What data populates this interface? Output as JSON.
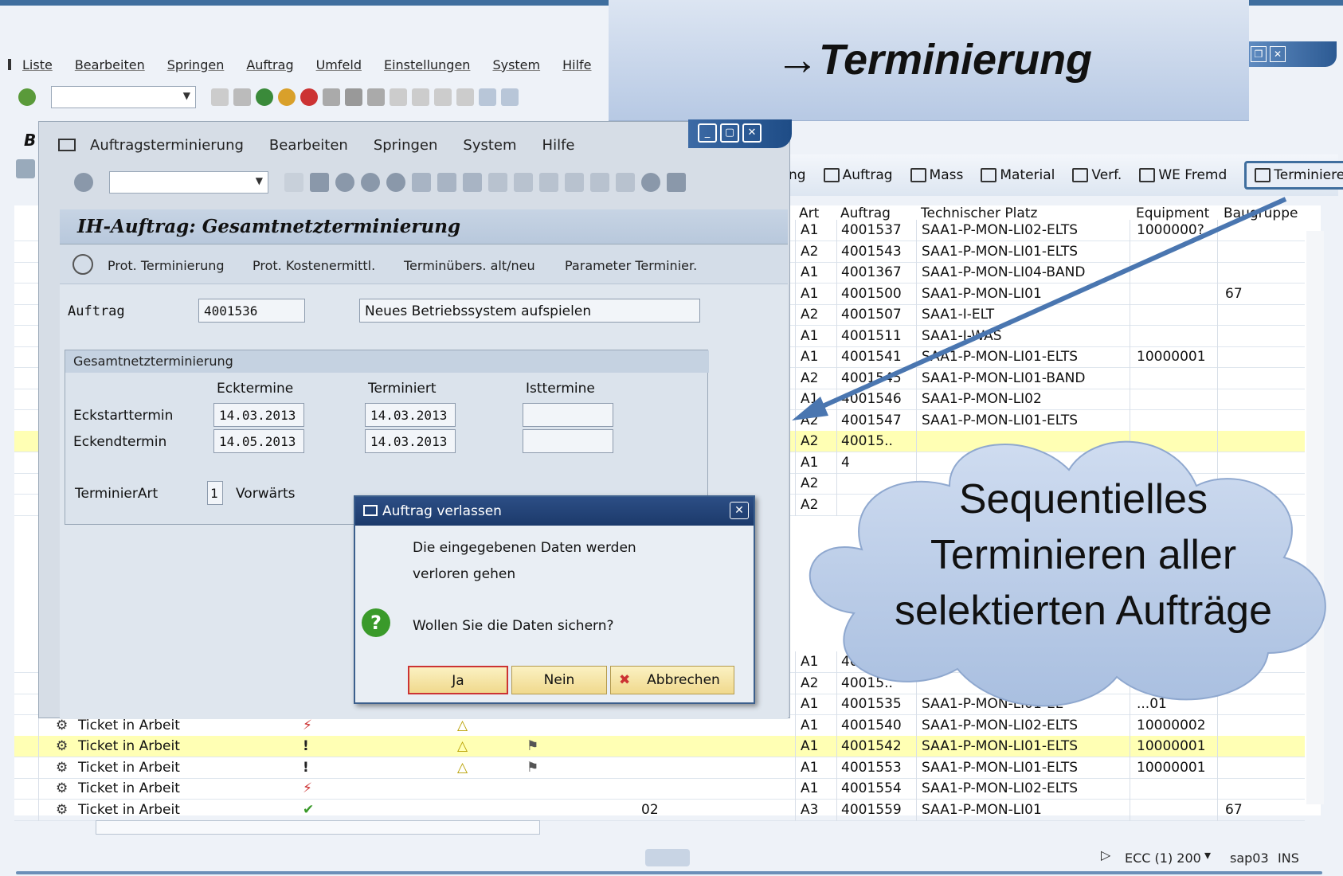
{
  "slide_title": "→Terminierung",
  "callout": {
    "line1": "Sequentielles",
    "line2": "Terminieren aller",
    "line3": "selektierten Aufträge"
  },
  "background_window": {
    "menu": [
      "Liste",
      "Bearbeiten",
      "Springen",
      "Auftrag",
      "Umfeld",
      "Einstellungen",
      "System",
      "Hilfe"
    ],
    "toolbar_buttons": [
      {
        "label": "Auftrag",
        "icon": "print-icon"
      },
      {
        "label": "Mass",
        "icon": "grid-icon"
      },
      {
        "label": "Material",
        "icon": "material-icon"
      },
      {
        "label": "Verf.",
        "icon": "verf-icon"
      },
      {
        "label": "WE Fremd",
        "icon": "edit-icon"
      },
      {
        "label": "Terminieren",
        "icon": "schedule-icon"
      }
    ],
    "toolbar_partial": "ng",
    "title_partial": "B",
    "columns": {
      "art": "Art",
      "auftrag": "Auftrag",
      "techplatz": "Technischer Platz",
      "equipment": "Equipment",
      "baugruppe": "Baugruppe"
    },
    "rows_top": [
      {
        "art": "A1",
        "auftrag": "4001537",
        "techplatz": "SAA1-P-MON-LI02-ELTS",
        "equipment": "1000000?",
        "baugruppe": ""
      },
      {
        "art": "A2",
        "auftrag": "4001543",
        "techplatz": "SAA1-P-MON-LI01-ELTS",
        "equipment": "",
        "baugruppe": ""
      },
      {
        "art": "A1",
        "auftrag": "4001367",
        "techplatz": "SAA1-P-MON-LI04-BAND",
        "equipment": "",
        "baugruppe": ""
      },
      {
        "art": "A1",
        "auftrag": "4001500",
        "techplatz": "SAA1-P-MON-LI01",
        "equipment": "",
        "baugruppe": "67"
      },
      {
        "art": "A2",
        "auftrag": "4001507",
        "techplatz": "SAA1-I-ELT",
        "equipment": "",
        "baugruppe": ""
      },
      {
        "art": "A1",
        "auftrag": "4001511",
        "techplatz": "SAA1-I-WAS",
        "equipment": "",
        "baugruppe": ""
      },
      {
        "art": "A1",
        "auftrag": "4001541",
        "techplatz": "SAA1-P-MON-LI01-ELTS",
        "equipment": "10000001",
        "baugruppe": ""
      },
      {
        "art": "A2",
        "auftrag": "4001545",
        "techplatz": "SAA1-P-MON-LI01-BAND",
        "equipment": "",
        "baugruppe": ""
      },
      {
        "art": "A1",
        "auftrag": "4001546",
        "techplatz": "SAA1-P-MON-LI02",
        "equipment": "",
        "baugruppe": ""
      },
      {
        "art": "A2",
        "auftrag": "4001547",
        "techplatz": "SAA1-P-MON-LI01-ELTS",
        "equipment": "",
        "baugruppe": ""
      },
      {
        "art": "A2",
        "auftrag": "40015..",
        "techplatz": "",
        "equipment": "",
        "baugruppe": ""
      },
      {
        "art": "A1",
        "auftrag": "4",
        "techplatz": "",
        "equipment": "",
        "baugruppe": ""
      },
      {
        "art": "A2",
        "auftrag": "",
        "techplatz": "",
        "equipment": "",
        "baugruppe": ""
      },
      {
        "art": "A2",
        "auftrag": "",
        "techplatz": "",
        "equipment": "",
        "baugruppe": ""
      }
    ],
    "rows_bottom": [
      {
        "status": "",
        "art": "A1",
        "auftrag": "4001",
        "techplatz": "",
        "equipment": "",
        "baugruppe": "",
        "extra": ""
      },
      {
        "status": "",
        "art": "A2",
        "auftrag": "40015..",
        "techplatz": "",
        "equipment": "",
        "baugruppe": "",
        "extra": ""
      },
      {
        "status": "",
        "art": "A1",
        "auftrag": "4001535",
        "techplatz": "SAA1-P-MON-LI01-EL",
        "equipment": "...01",
        "baugruppe": "",
        "extra": ""
      },
      {
        "status": "Ticket in Arbeit",
        "art": "A1",
        "auftrag": "4001540",
        "techplatz": "SAA1-P-MON-LI02-ELTS",
        "equipment": "10000002",
        "baugruppe": "",
        "extra": ""
      },
      {
        "status": "Ticket in Arbeit",
        "art": "A1",
        "auftrag": "4001542",
        "techplatz": "SAA1-P-MON-LI01-ELTS",
        "equipment": "10000001",
        "baugruppe": "",
        "extra": ""
      },
      {
        "status": "Ticket in Arbeit",
        "art": "A1",
        "auftrag": "4001553",
        "techplatz": "SAA1-P-MON-LI01-ELTS",
        "equipment": "10000001",
        "baugruppe": "",
        "extra": ""
      },
      {
        "status": "Ticket in Arbeit",
        "art": "A1",
        "auftrag": "4001554",
        "techplatz": "SAA1-P-MON-LI02-ELTS",
        "equipment": "",
        "baugruppe": "",
        "extra": ""
      },
      {
        "status": "Ticket in Arbeit",
        "art": "A3",
        "auftrag": "4001559",
        "techplatz": "SAA1-P-MON-LI01",
        "equipment": "",
        "baugruppe": "67",
        "extra": "02"
      }
    ],
    "status_bar": {
      "system": "ECC (1) 200",
      "server": "sap03",
      "mode": "INS"
    }
  },
  "sub_window": {
    "menu": [
      "Auftragsterminierung",
      "Bearbeiten",
      "Springen",
      "System",
      "Hilfe"
    ],
    "title": "IH-Auftrag:  Gesamtnetzterminierung",
    "actions": [
      "Prot. Terminierung",
      "Prot. Kostenermittl.",
      "Terminübers. alt/neu",
      "Parameter Terminier."
    ],
    "auftrag_label": "Auftrag",
    "auftrag_value": "4001536",
    "description": "Neues Betriebssystem aufspielen",
    "group_title": "Gesamtnetzterminierung",
    "col_ecktermine": "Ecktermine",
    "col_terminiert": "Terminiert",
    "col_isttermine": "Isttermine",
    "eckstart_label": "Eckstarttermin",
    "eckstart_ecktermin": "14.03.2013",
    "eckstart_terminiert": "14.03.2013",
    "eckstart_isttermin": "",
    "eckend_label": "Eckendtermin",
    "eckend_ecktermin": "14.05.2013",
    "eckend_terminiert": "14.03.2013",
    "eckend_isttermin": "",
    "terminierart_label": "TerminierArt",
    "terminierart_value": "1",
    "terminierart_text": "Vorwärts"
  },
  "dialog": {
    "title": "Auftrag verlassen",
    "message_line1": "Die eingegebenen Daten werden",
    "message_line2": "verloren gehen",
    "question": "Wollen Sie die Daten sichern?",
    "btn_yes": "Ja",
    "btn_no": "Nein",
    "btn_cancel": "Abbrechen"
  },
  "colors": {
    "accent": "#3f6e9e",
    "highlight_row": "#ffffb4",
    "dialog_title": "#1c3a6b",
    "cloud": "#b7c9e4"
  }
}
